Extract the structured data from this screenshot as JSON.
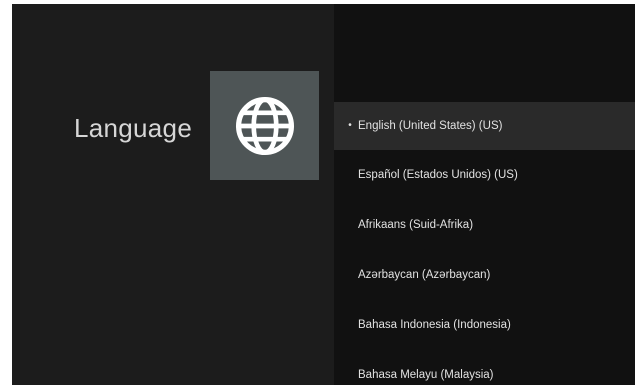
{
  "page": {
    "title": "Language",
    "icon": "globe-icon"
  },
  "languages": {
    "selected_marker": "•",
    "items": [
      {
        "label": "English (United States) (US)",
        "selected": true
      },
      {
        "label": "Español (Estados Unidos) (US)",
        "selected": false
      },
      {
        "label": "Afrikaans (Suid-Afrika)",
        "selected": false
      },
      {
        "label": "Azərbaycan (Azərbaycan)",
        "selected": false
      },
      {
        "label": "Bahasa Indonesia (Indonesia)",
        "selected": false
      },
      {
        "label": "Bahasa Melayu (Malaysia)",
        "selected": false
      }
    ]
  },
  "colors": {
    "background": "#1c1c1c",
    "list_background": "#111111",
    "selected_row": "#2a2a2a",
    "icon_tile": "#4e5556",
    "text": "#e2e2e2"
  }
}
